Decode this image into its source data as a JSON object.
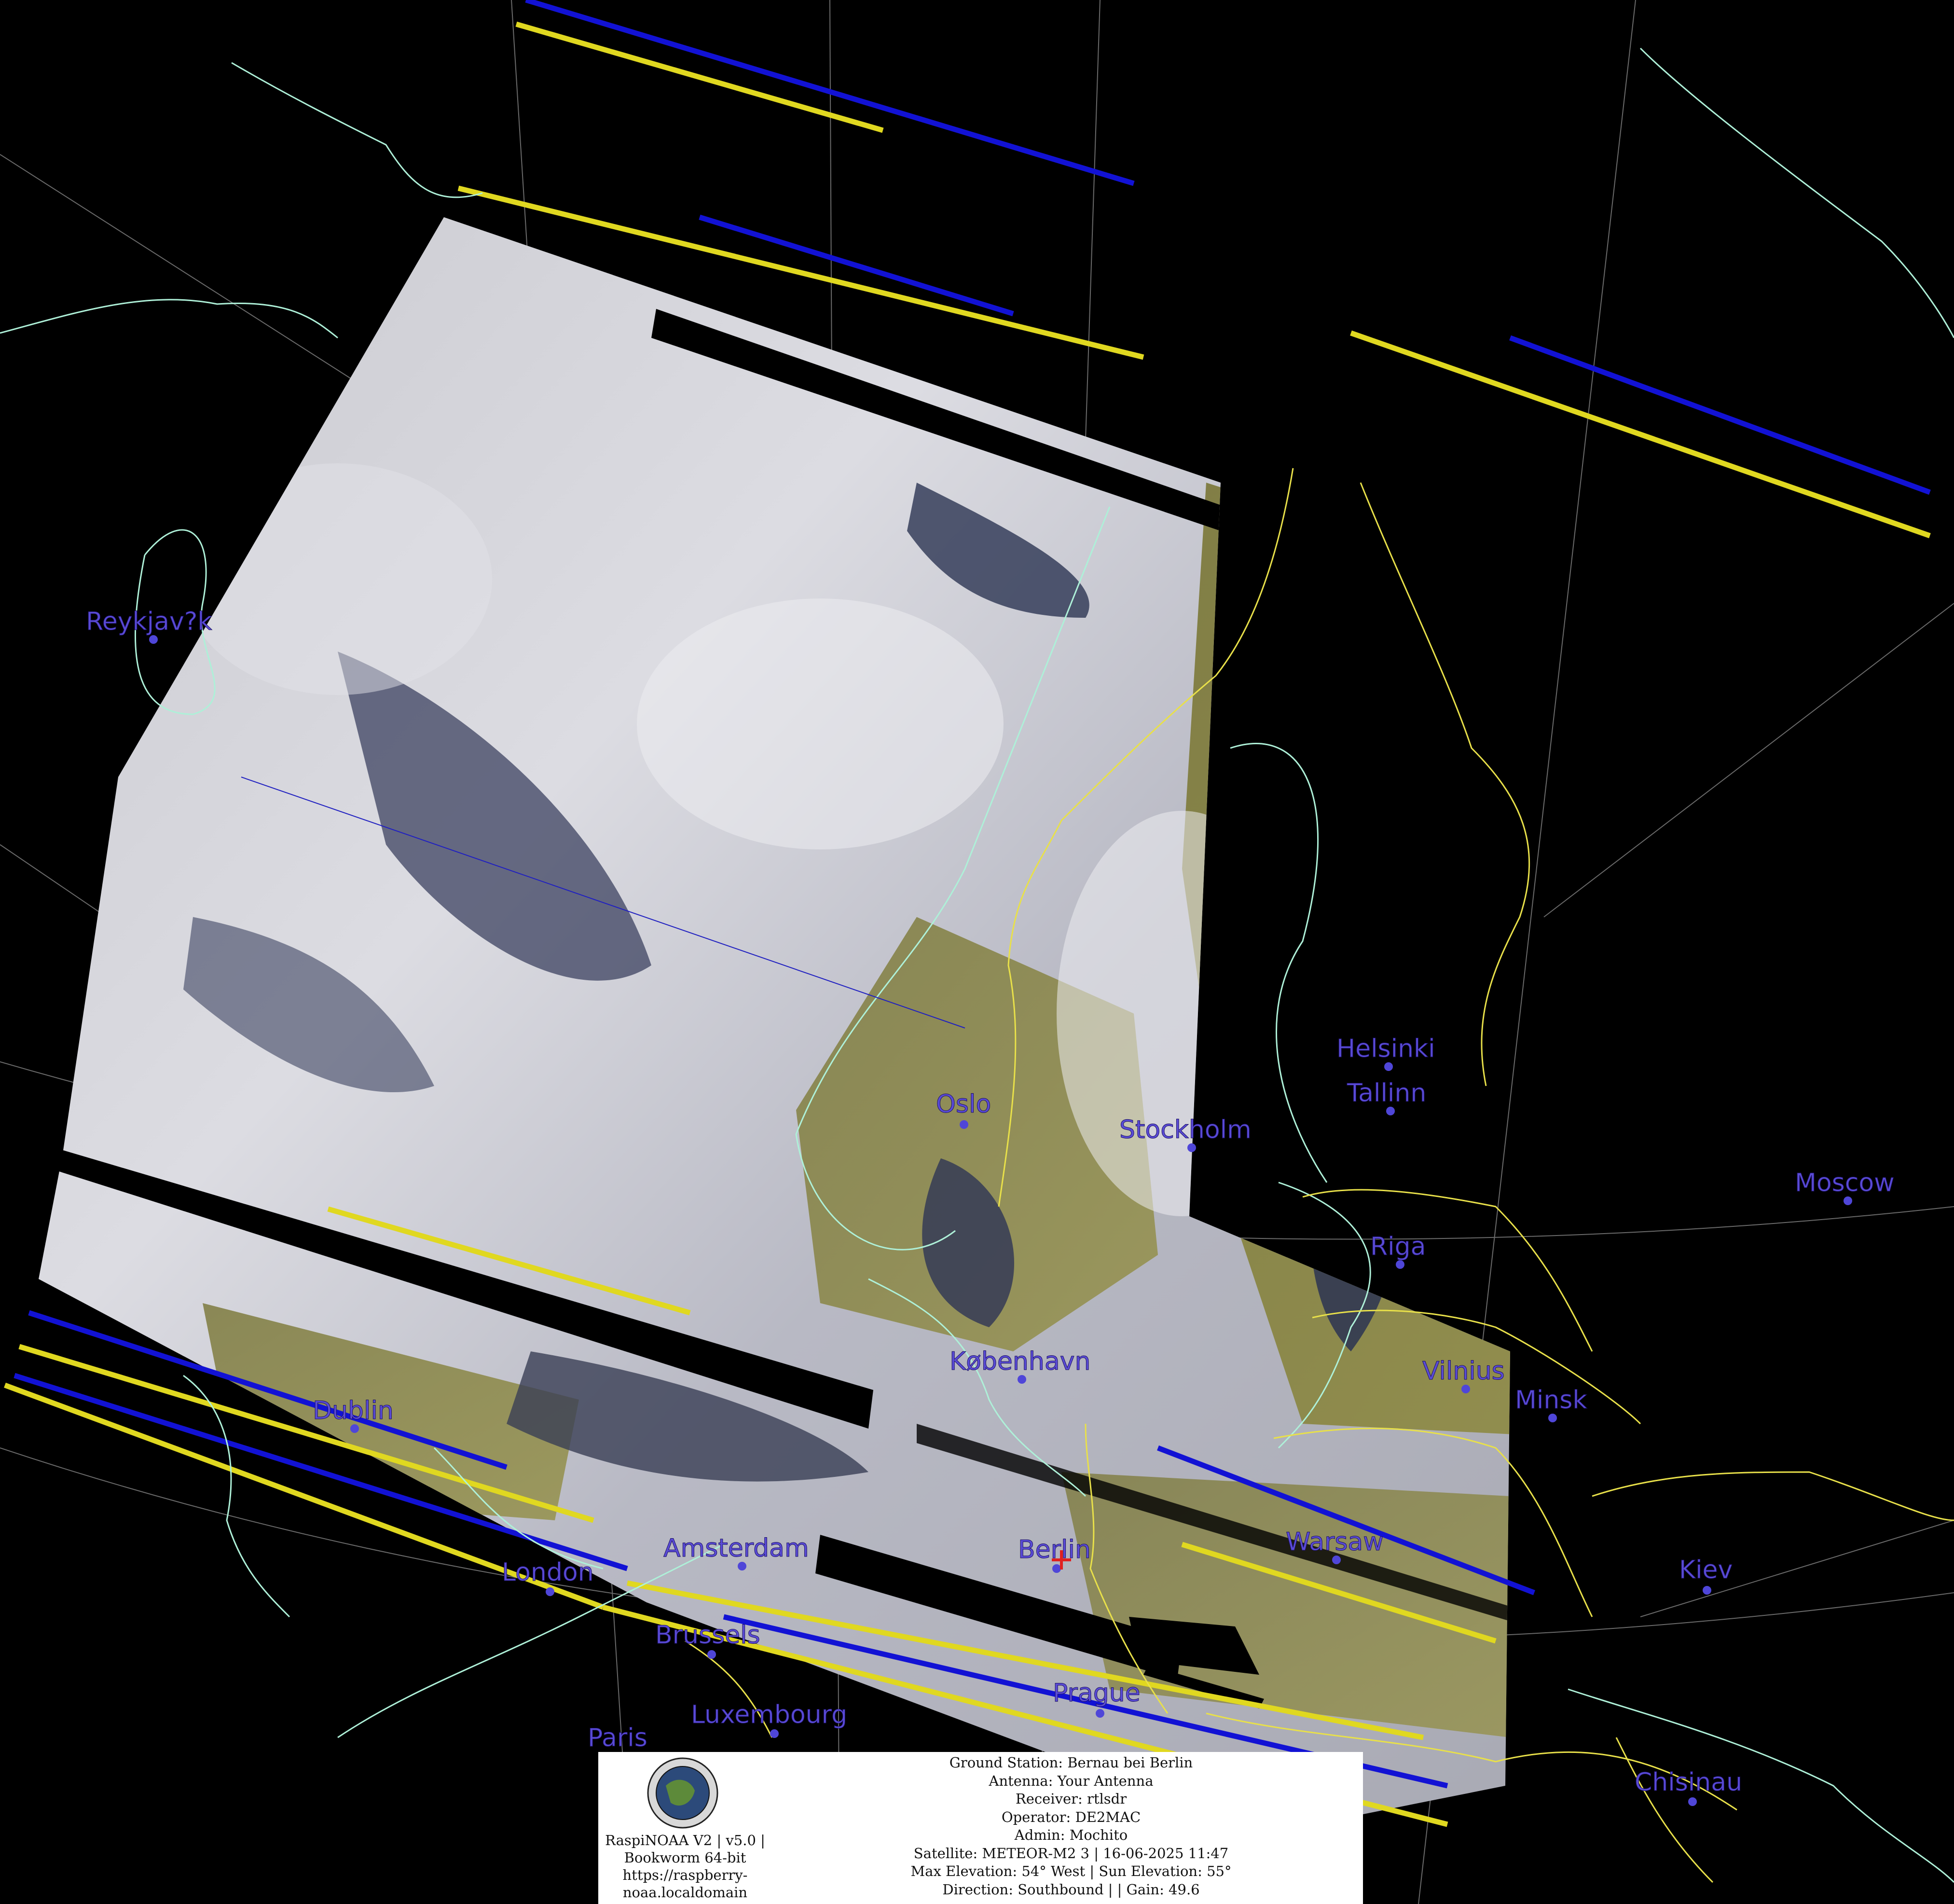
{
  "cities": [
    {
      "name": "Reykjav?k"
    },
    {
      "name": "Helsinki"
    },
    {
      "name": "Tallinn"
    },
    {
      "name": "Oslo"
    },
    {
      "name": "Stockholm"
    },
    {
      "name": "Moscow"
    },
    {
      "name": "Riga"
    },
    {
      "name": "København"
    },
    {
      "name": "Vilnius"
    },
    {
      "name": "Minsk"
    },
    {
      "name": "Dublin"
    },
    {
      "name": "Warsaw"
    },
    {
      "name": "Amsterdam"
    },
    {
      "name": "Berlin"
    },
    {
      "name": "London"
    },
    {
      "name": "Kiev"
    },
    {
      "name": "Brussels"
    },
    {
      "name": "Prague"
    },
    {
      "name": "Luxembourg"
    },
    {
      "name": "Paris"
    },
    {
      "name": "Chisinau"
    }
  ],
  "info": {
    "left": [
      "RaspiNOAA V2 | v5.0 |",
      "Bookworm 64-bit",
      "https://raspberry-",
      "noaa.localdomain"
    ],
    "right": [
      "Ground Station: Bernau bei Berlin",
      "Antenna: Your Antenna",
      "Receiver: rtlsdr",
      "Operator: DE2MAC",
      "Admin: Mochito",
      "Satellite: METEOR-M2 3 | 16-06-2025 11:47",
      "Max Elevation: 54° West | Sun Elevation: 55°",
      "Direction: Southbound | | Gain: 49.6"
    ]
  },
  "colors": {
    "background": "#000000",
    "coastline": "#aef0d8",
    "borders": "#e8e04a",
    "city": "#5a4bd6",
    "stripe_blue": "#1010d0",
    "stripe_yellow": "#e0d820"
  }
}
